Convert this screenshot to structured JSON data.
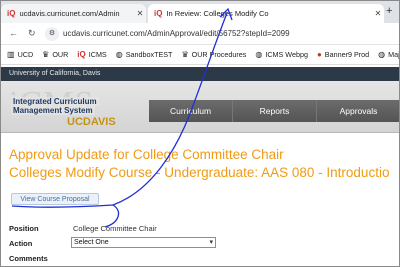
{
  "browser": {
    "tabs": [
      {
        "title": "ucdavis.curricunet.com/Admin",
        "favicon": "iQ"
      },
      {
        "title": "In Review: Colleges Modify Co",
        "favicon": "iQ"
      }
    ],
    "address": "ucdavis.curricunet.com/AdminApproval/edit/56752?stepId=2099",
    "bookmarks": [
      {
        "label": "UCD",
        "icon": "building-icon"
      },
      {
        "label": "OUR",
        "icon": "crown-icon"
      },
      {
        "label": "ICMS",
        "icon": "iq-icon"
      },
      {
        "label": "SandboxTEST",
        "icon": "globe-icon"
      },
      {
        "label": "OUR Procedures",
        "icon": "crown-icon"
      },
      {
        "label": "ICMS Webpg",
        "icon": "globe-icon"
      },
      {
        "label": "Banner9 Prod",
        "icon": "banner-icon"
      },
      {
        "label": "Maj",
        "icon": "globe-icon"
      }
    ]
  },
  "site": {
    "org_bar": "University of California, Davis",
    "logo_big": "iCMS",
    "logo_line1": "Integrated Curriculum",
    "logo_line2": "Management System",
    "logo_uc": "UCDAVIS",
    "nav": [
      "Curriculum",
      "Reports",
      "Approvals"
    ]
  },
  "page": {
    "title_line1": "Approval Update for College Committee Chair",
    "title_line2": "Colleges Modify Course - Undergraduate: AAS 080 - Introductio",
    "view_button": "View Course Proposal",
    "position_label": "Position",
    "position_value": "College Committee Chair",
    "action_label": "Action",
    "action_selected": "Select One",
    "comments_label": "Comments"
  },
  "colors": {
    "accent_orange": "#f09b12",
    "annotation_blue": "#1f2fd6",
    "nav_gray": "#5f5f5f"
  }
}
